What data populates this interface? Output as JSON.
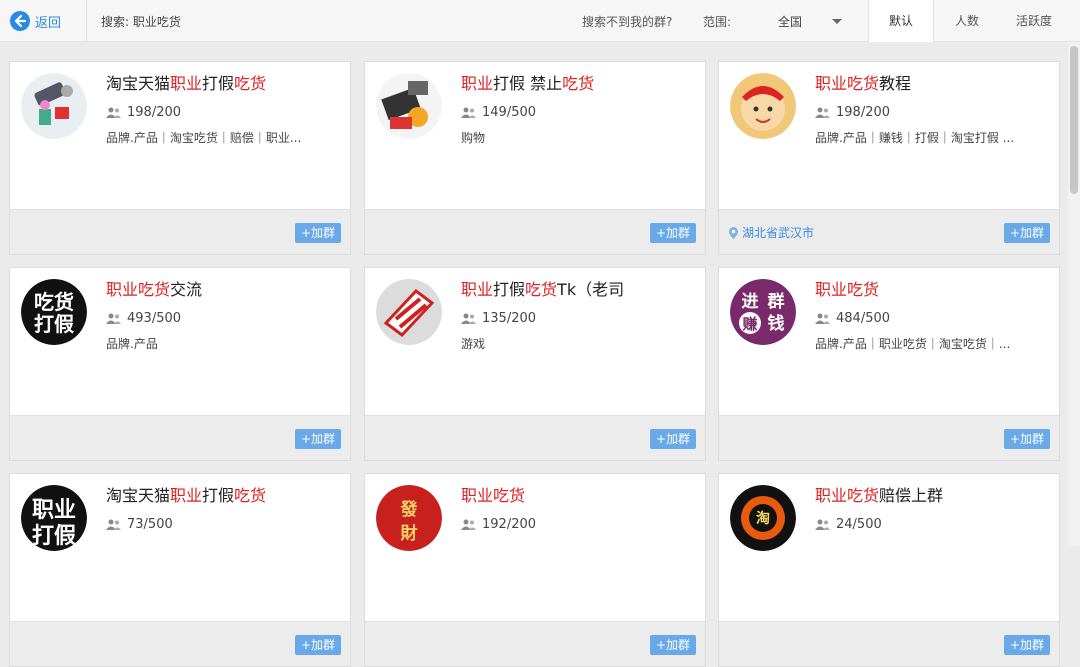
{
  "topbar": {
    "back_label": "返回",
    "search_label": "搜索: 职业吃货",
    "not_found": "搜索不到我的群?",
    "range_label": "范围:",
    "range_value": "全国",
    "sort_tabs": [
      "默认",
      "人数",
      "活跃度"
    ],
    "active_sort": "默认"
  },
  "join_label": "+加群",
  "cards": [
    {
      "title_parts": [
        "淘宝天猫",
        "职业",
        "打假",
        "吃货"
      ],
      "members": "198/200",
      "tags": "品牌.产品｜淘宝吃货｜赔偿｜职业...",
      "location": ""
    },
    {
      "title_parts": [
        "",
        "职业",
        "打假 禁止",
        "吃货"
      ],
      "members": "149/500",
      "tags": "购物",
      "location": ""
    },
    {
      "title_parts": [
        "",
        "职业吃货",
        "教程",
        ""
      ],
      "members": "198/200",
      "tags": "品牌.产品｜赚钱｜打假｜淘宝打假 ...",
      "location": "湖北省武汉市"
    },
    {
      "title_parts": [
        "",
        "职业吃货",
        "交流",
        ""
      ],
      "members": "493/500",
      "tags": "品牌.产品",
      "location": ""
    },
    {
      "title_parts": [
        "",
        "职业",
        "打假",
        "吃货",
        "Tk（老司"
      ],
      "members": "135/200",
      "tags": "游戏",
      "location": ""
    },
    {
      "title_parts": [
        "",
        "职业吃货",
        "",
        ""
      ],
      "members": "484/500",
      "tags": "品牌.产品｜职业吃货｜淘宝吃货｜...",
      "location": ""
    },
    {
      "title_parts": [
        "淘宝天猫",
        "职业",
        "打假",
        "吃货"
      ],
      "members": "73/500",
      "tags": "",
      "location": ""
    },
    {
      "title_parts": [
        "",
        "职业吃货",
        "",
        ""
      ],
      "members": "192/200",
      "tags": "",
      "location": ""
    },
    {
      "title_parts": [
        "",
        "职业吃货",
        "赔偿上群",
        ""
      ],
      "members": "24/500",
      "tags": "",
      "location": ""
    }
  ],
  "avatar_text": {
    "a4": [
      "吃货",
      "打假"
    ],
    "a6": [
      "进",
      "群",
      "赚",
      "钱"
    ],
    "a7": [
      "职业",
      "打假"
    ],
    "a8": [
      "發",
      "財"
    ],
    "a9": [
      "淘"
    ]
  },
  "colors": {
    "accent": "#2a8ae0",
    "highlight": "#e02020",
    "join": "#6aa9e8"
  },
  "icons": {
    "back": "back-arrow-icon",
    "members": "members-icon",
    "location": "location-pin-icon",
    "dropdown": "chevron-down-icon"
  }
}
